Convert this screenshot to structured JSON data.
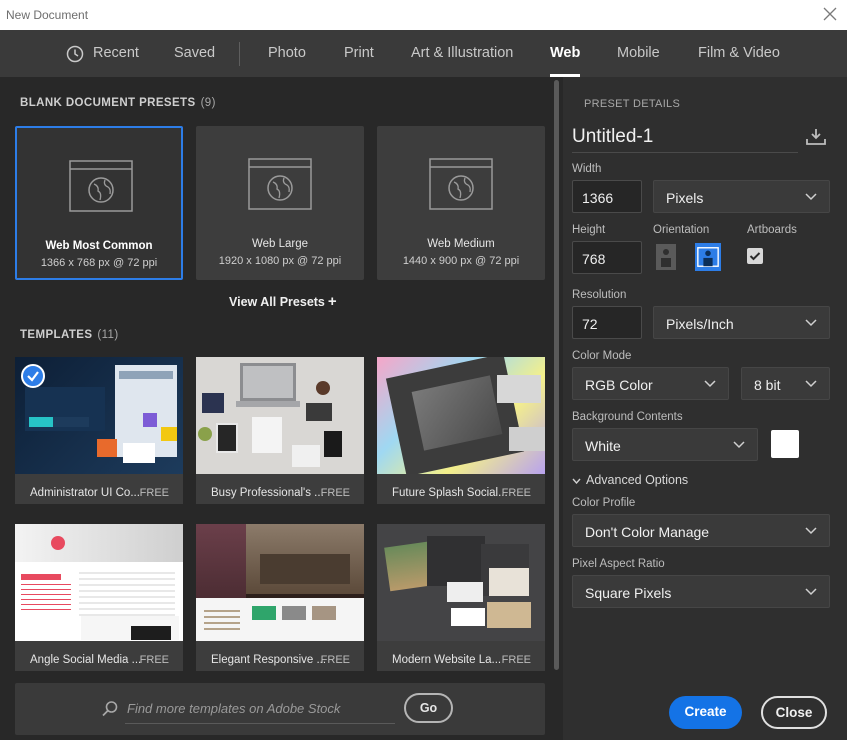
{
  "window": {
    "title": "New Document"
  },
  "tabs": [
    {
      "label": "Recent",
      "icon": "clock-icon"
    },
    {
      "label": "Saved"
    },
    {
      "label": "Photo"
    },
    {
      "label": "Print"
    },
    {
      "label": "Art & Illustration"
    },
    {
      "label": "Web",
      "active": true
    },
    {
      "label": "Mobile"
    },
    {
      "label": "Film & Video"
    }
  ],
  "presets_section": {
    "title": "BLANK DOCUMENT PRESETS",
    "count": "(9)",
    "view_all": "View All Presets",
    "items": [
      {
        "name": "Web Most Common",
        "spec": "1366 x 768 px @ 72 ppi",
        "selected": true
      },
      {
        "name": "Web Large",
        "spec": "1920 x 1080 px @ 72 ppi"
      },
      {
        "name": "Web Medium",
        "spec": "1440 x 900 px @ 72 ppi"
      }
    ]
  },
  "templates_section": {
    "title": "TEMPLATES",
    "count": "(11)",
    "items": [
      {
        "label": "Administrator UI Co...",
        "price": "FREE"
      },
      {
        "label": "Busy Professional's ...",
        "price": "FREE"
      },
      {
        "label": "Future Splash Social...",
        "price": "FREE"
      },
      {
        "label": "Angle Social Media ...",
        "price": "FREE"
      },
      {
        "label": "Elegant Responsive ...",
        "price": "FREE"
      },
      {
        "label": "Modern Website La...",
        "price": "FREE"
      }
    ]
  },
  "stock_search": {
    "placeholder": "Find more templates on Adobe Stock",
    "go_label": "Go"
  },
  "preset_details": {
    "header": "PRESET DETAILS",
    "document_name": "Untitled-1",
    "width_label": "Width",
    "width_value": "1366",
    "width_unit": "Pixels",
    "height_label": "Height",
    "height_value": "768",
    "orientation_label": "Orientation",
    "orientation": "landscape",
    "artboards_label": "Artboards",
    "artboards_checked": true,
    "resolution_label": "Resolution",
    "resolution_value": "72",
    "resolution_unit": "Pixels/Inch",
    "color_mode_label": "Color Mode",
    "color_mode": "RGB Color",
    "bit_depth": "8 bit",
    "background_label": "Background Contents",
    "background": "White",
    "background_color": "#ffffff",
    "advanced_label": "Advanced Options",
    "color_profile_label": "Color Profile",
    "color_profile": "Don't Color Manage",
    "pixel_aspect_label": "Pixel Aspect Ratio",
    "pixel_aspect": "Square Pixels"
  },
  "actions": {
    "create": "Create",
    "close": "Close"
  },
  "colors": {
    "accent": "#1473e6",
    "selection": "#2d7de7"
  }
}
